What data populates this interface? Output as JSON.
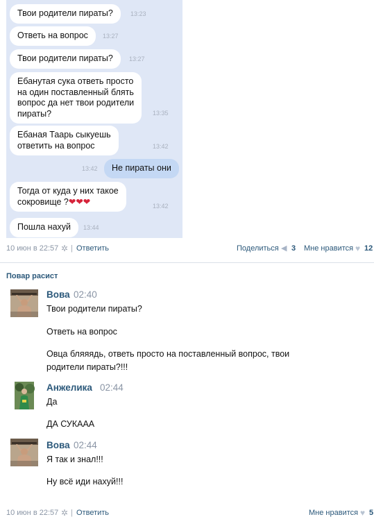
{
  "post1": {
    "chat": [
      {
        "text": "Твои родители пираты?",
        "time": "13:23"
      },
      {
        "text": "Ответь на вопрос",
        "time": "13:27"
      },
      {
        "text": "Твои родители пираты?",
        "time": "13:27"
      },
      {
        "lines": [
          "Ебанутая сука ответь просто",
          "на один поставленный блять",
          "вопрос да нет твои родители",
          "пираты?"
        ],
        "time": "13:35"
      },
      {
        "lines": [
          "Ебаная Таарь сыкуешь",
          "ответить на вопрос"
        ],
        "time": "13:42"
      },
      {
        "text": "Не пираты они",
        "time": "13:42"
      },
      {
        "lines": [
          "Тогда от куда у них такое",
          "сокровище ?"
        ],
        "hearts": "❤❤❤",
        "time": "13:42"
      },
      {
        "text": "Пошла нахуй",
        "time": "13:44"
      }
    ],
    "footer": {
      "date": "10 июн в 22:57",
      "reply": "Ответить",
      "share": "Поделиться",
      "share_count": "3",
      "like": "Мне нравится",
      "like_count": "12"
    }
  },
  "post2": {
    "title": "Повар расист",
    "comments": [
      {
        "author": "Вова",
        "time": "02:40",
        "messages": [
          "Твои родители пираты?",
          "Ответь на вопрос",
          "Овца бляяядь, ответь просто на поставленный вопрос, твои",
          "родители пираты?!!!"
        ]
      },
      {
        "author": "Анжелика",
        "time": "02:44",
        "messages": [
          "Да",
          "ДА СУКААА"
        ]
      },
      {
        "author": "Вова",
        "time": "02:44",
        "messages": [
          "Я так и знал!!!",
          "Ну всё иди нахуй!!!"
        ]
      }
    ],
    "footer": {
      "date": "10 июн в 22:57",
      "reply": "Ответить",
      "like": "Мне нравится",
      "like_count": "5"
    }
  },
  "icons": {
    "gear": "gear-icon",
    "megaphone": "megaphone-icon",
    "heart": "heart-icon"
  }
}
